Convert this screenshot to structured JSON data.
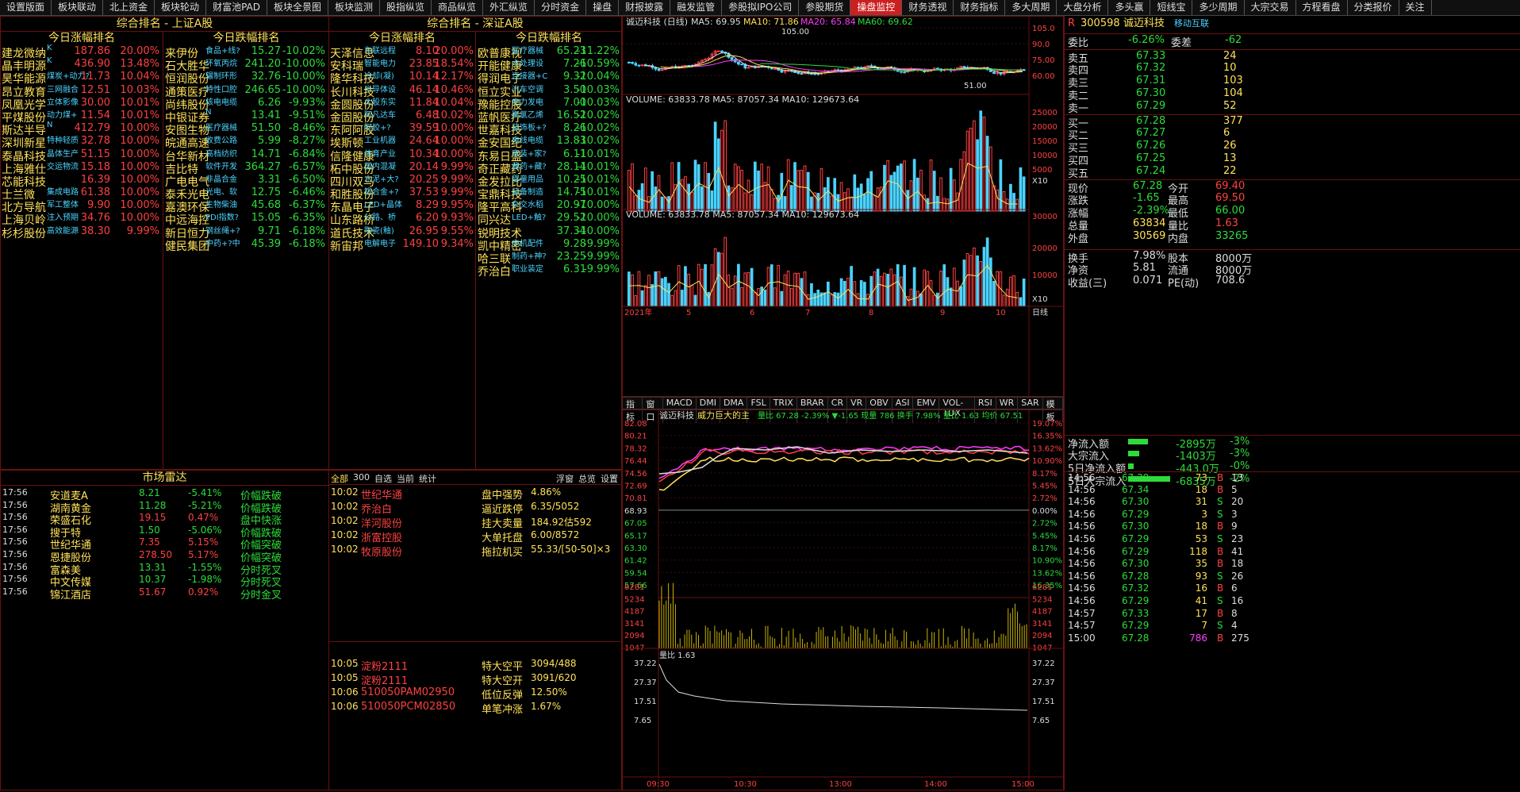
{
  "tabs": [
    "设置版面",
    "板块联动",
    "北上资金",
    "板块轮动",
    "财富池PAD",
    "板块全景图",
    "板块监测",
    "股指纵览",
    "商品纵览",
    "外汇纵览",
    "分时资金",
    "操盘",
    "财报披露",
    "融发监管",
    "参股拟IPO公司",
    "参股期货",
    "操盘监控",
    "财务透视",
    "财务指标",
    "多大周期",
    "大盘分析",
    "多头赢",
    "短线宝",
    "多少周期",
    "大宗交易",
    "方程看盘",
    "分类报价",
    "关注"
  ],
  "active_tab": "操盘监控",
  "sh_panel": {
    "title": "综合排名 - 上证A股",
    "rise_title": "今日涨幅排名",
    "fall_title": "今日跌幅排名",
    "rise": [
      {
        "name": "建龙微纳",
        "tag": "K",
        "price": "187.86",
        "pct": "20.00%"
      },
      {
        "name": "晶丰明源",
        "tag": "K",
        "price": "436.90",
        "pct": "13.48%"
      },
      {
        "name": "昊华能源",
        "tag": "煤炭+动力?",
        "price": "11.73",
        "pct": "10.04%"
      },
      {
        "name": "昂立教育",
        "tag": "三网融合",
        "price": "12.51",
        "pct": "10.03%"
      },
      {
        "name": "凤凰光学",
        "tag": "立体影像",
        "price": "30.00",
        "pct": "10.01%"
      },
      {
        "name": "平煤股份",
        "tag": "动力煤+",
        "price": "11.54",
        "pct": "10.01%"
      },
      {
        "name": "斯达半导",
        "tag": "N",
        "price": "412.79",
        "pct": "10.00%"
      },
      {
        "name": "深圳新星",
        "tag": "特种轻质",
        "price": "32.78",
        "pct": "10.00%"
      },
      {
        "name": "泰晶科技",
        "tag": "晶体生产",
        "price": "51.15",
        "pct": "10.00%"
      },
      {
        "name": "上海雅仕",
        "tag": "交运物流",
        "price": "15.18",
        "pct": "10.00%"
      },
      {
        "name": "芯能科技",
        "tag": "",
        "price": "16.39",
        "pct": "10.00%"
      },
      {
        "name": "士兰微",
        "tag": "集成电路",
        "price": "61.38",
        "pct": "10.00%"
      },
      {
        "name": "北方导航",
        "tag": "军工整体",
        "price": "9.90",
        "pct": "10.00%"
      },
      {
        "name": "上海贝岭",
        "tag": "注入预期",
        "price": "34.76",
        "pct": "10.00%"
      },
      {
        "name": "杉杉股份",
        "tag": "高效能源",
        "price": "38.30",
        "pct": "9.99%"
      }
    ],
    "fall": [
      {
        "name": "来伊份",
        "tag": "食品+线?",
        "price": "15.27",
        "pct": "-10.02%"
      },
      {
        "name": "石大胜华",
        "tag": "环氧丙烷",
        "price": "241.20",
        "pct": "-10.00%"
      },
      {
        "name": "恒润股份",
        "tag": "辗制环形",
        "price": "32.76",
        "pct": "-10.00%"
      },
      {
        "name": "通策医疗",
        "tag": "特性口腔",
        "price": "246.65",
        "pct": "-10.00%"
      },
      {
        "name": "尚纬股份",
        "tag": "核电电缆",
        "price": "6.26",
        "pct": "-9.93%"
      },
      {
        "name": "中银证券",
        "tag": "N",
        "price": "13.41",
        "pct": "-9.51%"
      },
      {
        "name": "安图生物",
        "tag": "医疗器械",
        "price": "51.50",
        "pct": "-8.46%"
      },
      {
        "name": "皖通高速",
        "tag": "收费公路",
        "price": "5.99",
        "pct": "-8.27%"
      },
      {
        "name": "台华新材",
        "tag": "高档纺织",
        "price": "14.71",
        "pct": "-6.84%"
      },
      {
        "name": "吉比特",
        "tag": "软件开发",
        "price": "364.27",
        "pct": "-6.57%"
      },
      {
        "name": "广电电气",
        "tag": "非晶合金",
        "price": "3.31",
        "pct": "-6.50%"
      },
      {
        "name": "泰禾光电",
        "tag": "光电、软",
        "price": "12.75",
        "pct": "-6.46%"
      },
      {
        "name": "嘉澳环保",
        "tag": "生物柴油",
        "price": "45.68",
        "pct": "-6.37%"
      },
      {
        "name": "中远海控",
        "tag": "PDI指数?",
        "price": "15.05",
        "pct": "-6.35%"
      },
      {
        "name": "新日恒力",
        "tag": "钢丝绳+?",
        "price": "9.71",
        "pct": "-6.18%"
      },
      {
        "name": "健民集团",
        "tag": "中药+?中",
        "price": "45.39",
        "pct": "-6.18%"
      }
    ]
  },
  "sz_panel": {
    "title": "综合排名 - 深证A股",
    "rise_title": "今日涨幅排名",
    "fall_title": "今日跌幅排名",
    "rise": [
      {
        "name": "天泽信息",
        "tag": "车联远程",
        "price": "8.10",
        "pct": "20.00%"
      },
      {
        "name": "安科瑞",
        "tag": "智能电力",
        "price": "23.85",
        "pct": "18.54%"
      },
      {
        "name": "隆华科技",
        "tag": "冷却(凝)",
        "price": "10.14",
        "pct": "12.17%"
      },
      {
        "name": "长川科技",
        "tag": "半导体设",
        "price": "46.14",
        "pct": "10.46%"
      },
      {
        "name": "金圆股份",
        "tag": "大股东实",
        "price": "11.84",
        "pct": "10.04%"
      },
      {
        "name": "金固股份",
        "tag": "阿凡达车",
        "price": "6.48",
        "pct": "10.02%"
      },
      {
        "name": "东阿阿胶",
        "tag": "阿胶+?",
        "price": "39.59",
        "pct": "10.00%"
      },
      {
        "name": "埃斯顿",
        "tag": "工业机器",
        "price": "24.64",
        "pct": "10.00%"
      },
      {
        "name": "信隆健康",
        "tag": "体育产业",
        "price": "10.34",
        "pct": "10.00%"
      },
      {
        "name": "柘中股份",
        "tag": "国内混凝",
        "price": "20.14",
        "pct": "9.99%"
      },
      {
        "name": "四川双马",
        "tag": "水泥+大?",
        "price": "20.25",
        "pct": "9.99%"
      },
      {
        "name": "和胜股份",
        "tag": "铝合金+?",
        "price": "37.53",
        "pct": "9.99%"
      },
      {
        "name": "东晶电子",
        "tag": "LED+晶体",
        "price": "8.29",
        "pct": "9.95%"
      },
      {
        "name": "山东路桥",
        "tag": "公路、桥",
        "price": "6.20",
        "pct": "9.93%"
      },
      {
        "name": "道氏技术",
        "tag": "陶瓷(釉)",
        "price": "26.95",
        "pct": "9.55%"
      },
      {
        "name": "新宙邦",
        "tag": "电解电子",
        "price": "149.10",
        "pct": "9.34%"
      }
    ],
    "fall": [
      {
        "name": "欧普康视",
        "tag": "医疗器械",
        "price": "65.23",
        "pct": "-11.22%"
      },
      {
        "name": "开能健康",
        "tag": "水处理设",
        "price": "7.26",
        "pct": "-10.59%"
      },
      {
        "name": "得润电子",
        "tag": "连接器+C",
        "price": "9.32",
        "pct": "-10.04%"
      },
      {
        "name": "恒立实业",
        "tag": "汽车空调",
        "price": "3.50",
        "pct": "-10.03%"
      },
      {
        "name": "豫能控股",
        "tag": "电力发电",
        "price": "7.00",
        "pct": "-10.03%"
      },
      {
        "name": "蓝帆医疗",
        "tag": "聚氯乙烯",
        "price": "16.52",
        "pct": "-10.02%"
      },
      {
        "name": "世嘉科技",
        "tag": "装饰板+?",
        "price": "8.26",
        "pct": "-10.02%"
      },
      {
        "name": "金安国纪",
        "tag": "电线电缆",
        "price": "13.83",
        "pct": "-10.02%"
      },
      {
        "name": "东易日盛",
        "tag": "家装+家?",
        "price": "6.11",
        "pct": "-10.01%"
      },
      {
        "name": "奇正藏药",
        "tag": "藏药+藏?",
        "price": "28.14",
        "pct": "-10.01%"
      },
      {
        "name": "金发拉比",
        "tag": "婴童用品",
        "price": "10.25",
        "pct": "-10.01%"
      },
      {
        "name": "宝鼎科技",
        "tag": "装备制造",
        "price": "14.75",
        "pct": "-10.01%"
      },
      {
        "name": "隆平高科",
        "tag": "杂交水稻",
        "price": "20.97",
        "pct": "-10.00%"
      },
      {
        "name": "同兴达",
        "tag": "LED+触?",
        "price": "29.52",
        "pct": "-10.00%"
      },
      {
        "name": "锐明技术",
        "tag": "",
        "price": "37.34",
        "pct": "-10.00%"
      },
      {
        "name": "凯中精密",
        "tag": "电机配件",
        "price": "9.28",
        "pct": "-9.99%"
      },
      {
        "name": "哈三联",
        "tag": "制药+神?",
        "price": "23.25",
        "pct": "-9.99%"
      },
      {
        "name": "乔治白",
        "tag": "职业装定",
        "price": "6.31",
        "pct": "-9.99%"
      }
    ]
  },
  "radar": {
    "title": "市场雷达",
    "rows": [
      {
        "time": "17:56",
        "name": "安道麦A",
        "price": "8.21",
        "pct": "-5.41%",
        "event": "价幅跌破"
      },
      {
        "time": "17:56",
        "name": "湖南黄金",
        "price": "11.28",
        "pct": "-5.21%",
        "event": "价幅跌破"
      },
      {
        "time": "17:56",
        "name": "荣盛石化",
        "price": "19.15",
        "pct": "0.47%",
        "event": "盘中快涨"
      },
      {
        "time": "17:56",
        "name": "搜于特",
        "price": "1.50",
        "pct": "-5.06%",
        "event": "价幅跌破"
      },
      {
        "time": "17:56",
        "name": "世纪华通",
        "price": "7.35",
        "pct": "5.15%",
        "event": "价幅突破"
      },
      {
        "time": "17:56",
        "name": "恩捷股份",
        "price": "278.50",
        "pct": "5.17%",
        "event": "价幅突破"
      },
      {
        "time": "17:56",
        "name": "富森美",
        "price": "13.31",
        "pct": "-1.55%",
        "event": "分时死叉"
      },
      {
        "time": "17:56",
        "name": "中文传媒",
        "price": "10.37",
        "pct": "-1.98%",
        "event": "分时死叉"
      },
      {
        "time": "17:56",
        "name": "锦江酒店",
        "price": "51.67",
        "pct": "0.92%",
        "event": "分时金叉"
      }
    ]
  },
  "monitor": {
    "tabs": [
      "全部",
      "300",
      "自选",
      "当前",
      "统计"
    ],
    "actions": [
      "浮窗",
      "总览",
      "设置"
    ],
    "top_rows": [
      {
        "time": "10:02",
        "name": "世纪华通",
        "event": "盘中强势",
        "value": "4.86%"
      },
      {
        "time": "10:02",
        "name": "乔治白",
        "event": "逼近跌停",
        "value": "6.35/5052"
      },
      {
        "time": "10:02",
        "name": "洋河股份",
        "event": "挂大卖量",
        "value": "184.92估592"
      },
      {
        "time": "10:02",
        "name": "浙富控股",
        "event": "大单托盘",
        "value": "6.00/8572"
      },
      {
        "time": "10:02",
        "name": "牧原股份",
        "event": "拖拉机买",
        "value": "55.33/[50-50]×3"
      }
    ],
    "bottom_rows": [
      {
        "time": "10:05",
        "name": "淀粉2111",
        "event": "特大空平",
        "value": "3094/488"
      },
      {
        "time": "10:05",
        "name": "淀粉2111",
        "event": "特大空开",
        "value": "3091/620"
      },
      {
        "time": "10:06",
        "name": "510050PAM02950",
        "event": "低位反弹",
        "value": "12.50%"
      },
      {
        "time": "10:06",
        "name": "510050PCM02850",
        "event": "单笔冲涨",
        "value": "1.67%"
      }
    ]
  },
  "kline": {
    "header": "诚迈科技 (日线)",
    "ma5": "MA5: 69.95",
    "ma10": "MA10: 71.86",
    "ma20": "MA20: 65.84",
    "ma60": "MA60: 69.62",
    "high_label": "105.00",
    "low_label": "51.00",
    "axis": [
      "105.0",
      "90.0",
      "75.00",
      "60.00"
    ],
    "vol1_header": "VOLUME: 63833.78  MA5: 87057.34  MA10: 129673.64",
    "vol1_axis": [
      "25000",
      "20000",
      "15000",
      "10000",
      "5000",
      "X10"
    ],
    "vol2_header": "VOLUME: 63833.78  MA5: 87057.34  MA10: 129673.64",
    "vol2_axis": [
      "30000",
      "20000",
      "10000",
      "X10"
    ],
    "date_labels": [
      "2021年",
      "5",
      "6",
      "7",
      "8",
      "9",
      "10"
    ],
    "period": "日线",
    "indicators": [
      "指标",
      "窗口",
      "MACD",
      "DMI",
      "DMA",
      "FSL",
      "TRIX",
      "BRAR",
      "CR",
      "VR",
      "OBV",
      "ASI",
      "EMV",
      "VOL-TDX",
      "RSI",
      "WR",
      "SAR"
    ],
    "template_label": "模板"
  },
  "intraday": {
    "header_name": "诚迈科技",
    "header_tag": "威力巨大的主",
    "header_ratio": "量比 67.28 -2.39% ▼-1.65 现量 786 换手 7.98% 量比 1.63 均价 67.51",
    "left_axis": [
      "82.08",
      "80.21",
      "78.32",
      "76.44",
      "74.56",
      "72.69",
      "70.81",
      "68.93",
      "67.05",
      "65.17",
      "63.30",
      "61.42",
      "59.54",
      "57.66"
    ],
    "right_axis": [
      "19.07%",
      "16.35%",
      "13.62%",
      "10.90%",
      "8.17%",
      "5.45%",
      "2.72%",
      "0.00%",
      "2.72%",
      "5.45%",
      "8.17%",
      "10.90%",
      "13.62%",
      "16.35%"
    ],
    "vol_axis": [
      "6281",
      "5234",
      "4187",
      "3141",
      "2094",
      "1047"
    ],
    "ratio_label": "量比 1.63",
    "ratio_axis": [
      "37.22",
      "27.37",
      "17.51",
      "7.65"
    ],
    "time_axis": [
      "09:30",
      "10:30",
      "13:00",
      "14:00",
      "15:00"
    ]
  },
  "quote": {
    "code": "300598",
    "name": "诚迈科技",
    "badge": "移动互联",
    "r_label": "R",
    "webi_label": "委比",
    "webi": "-6.26%",
    "weicha_label": "委差",
    "weicha": "-62",
    "sells": [
      {
        "label": "卖五",
        "price": "67.33",
        "vol": "24"
      },
      {
        "label": "卖四",
        "price": "67.32",
        "vol": "10"
      },
      {
        "label": "卖三",
        "price": "67.31",
        "vol": "103"
      },
      {
        "label": "卖二",
        "price": "67.30",
        "vol": "104"
      },
      {
        "label": "卖一",
        "price": "67.29",
        "vol": "52"
      }
    ],
    "buys": [
      {
        "label": "买一",
        "price": "67.28",
        "vol": "377"
      },
      {
        "label": "买二",
        "price": "67.27",
        "vol": "6"
      },
      {
        "label": "买三",
        "price": "67.26",
        "vol": "26"
      },
      {
        "label": "买四",
        "price": "67.25",
        "vol": "13"
      },
      {
        "label": "买五",
        "price": "67.24",
        "vol": "22"
      }
    ],
    "stats": [
      {
        "l1": "现价",
        "v1": "67.28",
        "l2": "今开",
        "v2": "69.40"
      },
      {
        "l1": "涨跌",
        "v1": "-1.65",
        "l2": "最高",
        "v2": "69.50"
      },
      {
        "l1": "涨幅",
        "v1": "-2.39%",
        "l2": "最低",
        "v2": "66.00"
      },
      {
        "l1": "总量",
        "v1": "63834",
        "l2": "量比",
        "v2": "1.63"
      },
      {
        "l1": "外盘",
        "v1": "30569",
        "l2": "内盘",
        "v2": "33265"
      }
    ],
    "stats2": [
      {
        "l1": "换手",
        "v1": "7.98%",
        "l2": "股本",
        "v2": "8000万"
      },
      {
        "l1": "净资",
        "v1": "5.81",
        "l2": "流通",
        "v2": "8000万"
      },
      {
        "l1": "收益(三)",
        "v1": "0.071",
        "l2": "PE(动)",
        "v2": "708.6"
      }
    ],
    "flows": [
      {
        "label": "净流入额",
        "value": "-2895万",
        "pct": "-3%",
        "bar": 0.45
      },
      {
        "label": "大宗流入",
        "value": "-1403万",
        "pct": "-3%",
        "bar": 0.25
      },
      {
        "label": "5日净流入额",
        "value": "-443.0万",
        "pct": "-0%",
        "bar": 0.12
      },
      {
        "label": "5日大宗流入",
        "value": "-6835万",
        "pct": "-2%",
        "bar": 0.95
      }
    ],
    "ticks": [
      {
        "time": "14:56",
        "price": "67.39",
        "vol": "73",
        "bs": "B",
        "n": "13"
      },
      {
        "time": "14:56",
        "price": "67.34",
        "vol": "18",
        "bs": "B",
        "n": "5"
      },
      {
        "time": "14:56",
        "price": "67.30",
        "vol": "31",
        "bs": "S",
        "n": "20"
      },
      {
        "time": "14:56",
        "price": "67.29",
        "vol": "3",
        "bs": "S",
        "n": "3"
      },
      {
        "time": "14:56",
        "price": "67.30",
        "vol": "18",
        "bs": "B",
        "n": "9"
      },
      {
        "time": "14:56",
        "price": "67.29",
        "vol": "53",
        "bs": "S",
        "n": "23"
      },
      {
        "time": "14:56",
        "price": "67.29",
        "vol": "118",
        "bs": "B",
        "n": "41"
      },
      {
        "time": "14:56",
        "price": "67.30",
        "vol": "35",
        "bs": "B",
        "n": "18"
      },
      {
        "time": "14:56",
        "price": "67.28",
        "vol": "93",
        "bs": "S",
        "n": "26"
      },
      {
        "time": "14:56",
        "price": "67.32",
        "vol": "16",
        "bs": "B",
        "n": "6"
      },
      {
        "time": "14:56",
        "price": "67.29",
        "vol": "41",
        "bs": "S",
        "n": "16"
      },
      {
        "time": "14:57",
        "price": "67.33",
        "vol": "17",
        "bs": "B",
        "n": "8"
      },
      {
        "time": "14:57",
        "price": "67.29",
        "vol": "7",
        "bs": "S",
        "n": "4"
      },
      {
        "time": "15:00",
        "price": "67.28",
        "vol": "786",
        "bs": "B",
        "n": "275"
      }
    ]
  },
  "colors": {
    "up": "#ff4040",
    "down": "#2ddc3a",
    "name": "#ffe15a",
    "tag": "#4bd3ff",
    "border": "#6a1010"
  }
}
